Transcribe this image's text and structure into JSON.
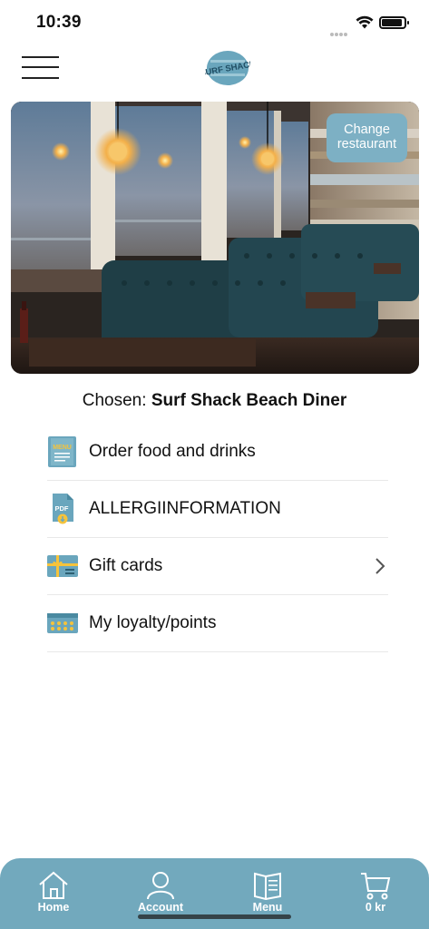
{
  "status_bar": {
    "time": "10:39"
  },
  "header": {
    "logo_text": "SURF SHACK"
  },
  "hero": {
    "change_label_line1": "Change",
    "change_label_line2": "restaurant"
  },
  "chosen": {
    "prefix": "Chosen:",
    "name": "Surf Shack Beach Diner"
  },
  "menu": {
    "items": [
      {
        "label": "Order food and drinks",
        "icon": "menu-book-icon",
        "icon_text": "MENU"
      },
      {
        "label": "ALLERGIINFORMATION",
        "icon": "pdf-download-icon",
        "icon_text": "PDF"
      },
      {
        "label": "Gift cards",
        "icon": "gift-card-icon",
        "has_chevron": true
      },
      {
        "label": "My loyalty/points",
        "icon": "loyalty-card-icon"
      }
    ]
  },
  "tabbar": {
    "tabs": [
      {
        "label": "Home",
        "icon": "home-icon"
      },
      {
        "label": "Account",
        "icon": "person-icon"
      },
      {
        "label": "Menu",
        "icon": "menu-book-icon"
      },
      {
        "label": "0 kr",
        "icon": "cart-icon"
      }
    ]
  },
  "colors": {
    "accent": "#72a9bd",
    "button": "#7db0c4",
    "icon_fill": "#6aa6bd",
    "icon_yellow": "#f5c33b"
  }
}
